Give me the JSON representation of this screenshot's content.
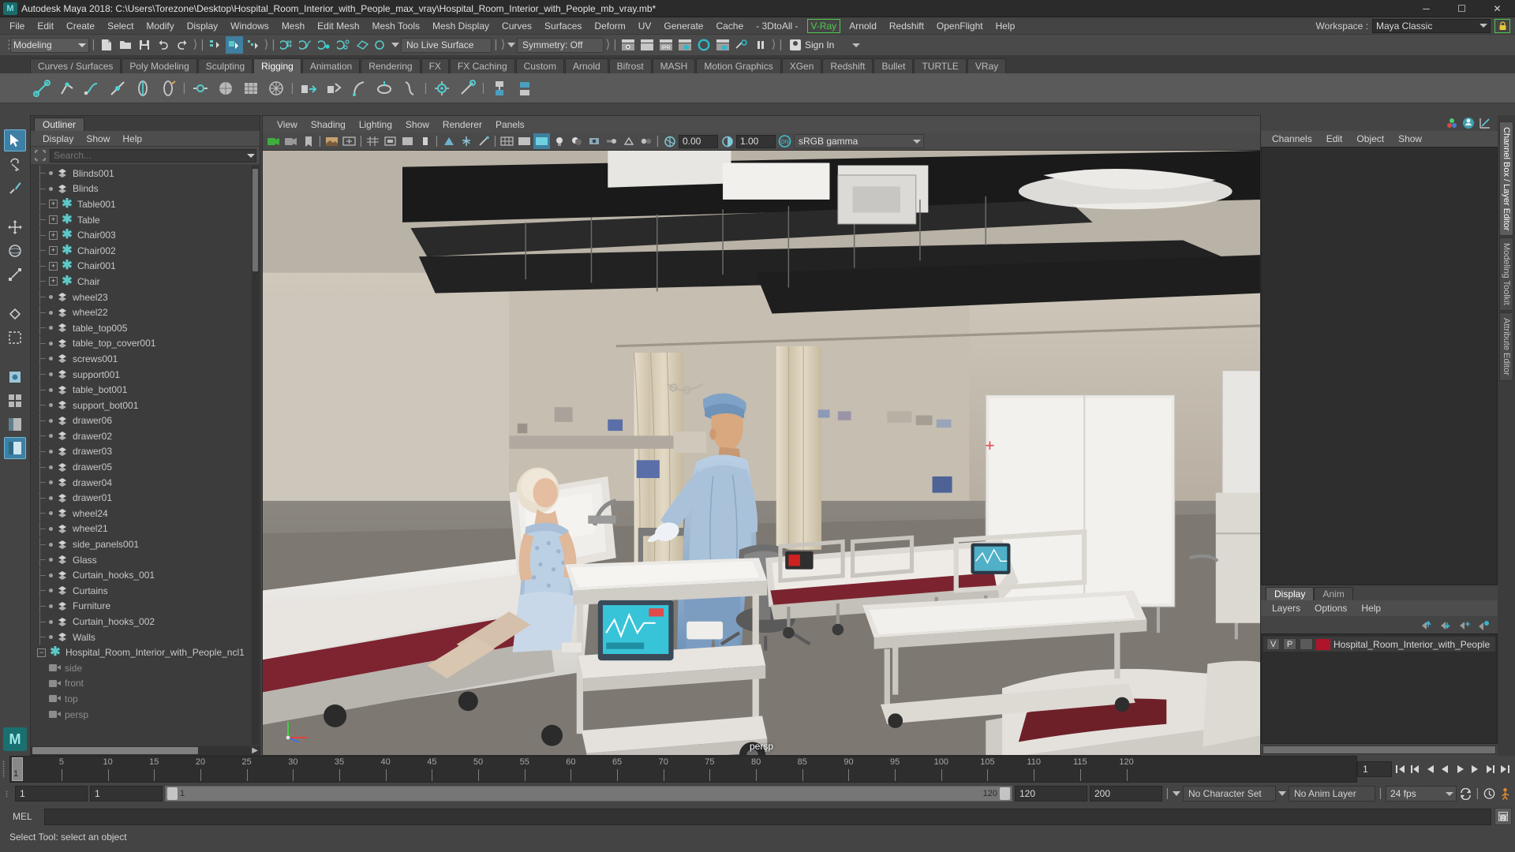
{
  "window": {
    "title": "Autodesk Maya 2018: C:\\Users\\Torezone\\Desktop\\Hospital_Room_Interior_with_People_max_vray\\Hospital_Room_Interior_with_People_mb_vray.mb*",
    "logo": "maya-logo",
    "minimize": "─",
    "maximize": "☐",
    "close": "✕"
  },
  "menubar": {
    "items": [
      "File",
      "Edit",
      "Create",
      "Select",
      "Modify",
      "Display",
      "Windows",
      "Mesh",
      "Edit Mesh",
      "Mesh Tools",
      "Mesh Display",
      "Curves",
      "Surfaces",
      "Deform",
      "UV",
      "Generate",
      "Cache",
      "- 3DtoAll -"
    ],
    "highlighted": "V-Ray",
    "items_after": [
      "Arnold",
      "Redshift",
      "OpenFlight",
      "Help"
    ],
    "workspace_label": "Workspace :",
    "workspace_value": "Maya Classic",
    "lock_icon": "lock-icon",
    "highlight_color": "#4ec94e"
  },
  "statusbar": {
    "mode": "Modeling",
    "live_surface": "No Live Surface",
    "symmetry": "Symmetry: Off",
    "sign_in": "Sign In"
  },
  "shelf": {
    "tabs": [
      "Curves / Surfaces",
      "Poly Modeling",
      "Sculpting",
      "Rigging",
      "Animation",
      "Rendering",
      "FX",
      "FX Caching",
      "Custom",
      "Arnold",
      "Bifrost",
      "MASH",
      "Motion Graphics",
      "XGen",
      "Redshift",
      "Bullet",
      "TURTLE",
      "VRay"
    ],
    "active_tab": "Rigging"
  },
  "outliner": {
    "tab": "Outliner",
    "menu": [
      "Display",
      "Show",
      "Help"
    ],
    "search_placeholder": "Search...",
    "search_icon": "search-icon",
    "nodes": [
      {
        "label": "persp",
        "type": "camera",
        "depth": 0,
        "dim": true
      },
      {
        "label": "top",
        "type": "camera",
        "depth": 0,
        "dim": true
      },
      {
        "label": "front",
        "type": "camera",
        "depth": 0,
        "dim": true
      },
      {
        "label": "side",
        "type": "camera",
        "depth": 0,
        "dim": true
      },
      {
        "label": "Hospital_Room_Interior_with_People_ncl1",
        "type": "group",
        "depth": 0,
        "expanded": true
      },
      {
        "label": "Walls",
        "type": "mesh",
        "depth": 1
      },
      {
        "label": "Curtain_hooks_002",
        "type": "mesh",
        "depth": 1
      },
      {
        "label": "Furniture",
        "type": "mesh",
        "depth": 1
      },
      {
        "label": "Curtains",
        "type": "mesh",
        "depth": 1
      },
      {
        "label": "Curtain_hooks_001",
        "type": "mesh",
        "depth": 1
      },
      {
        "label": "Glass",
        "type": "mesh",
        "depth": 1
      },
      {
        "label": "side_panels001",
        "type": "mesh",
        "depth": 1
      },
      {
        "label": "wheel21",
        "type": "mesh",
        "depth": 1
      },
      {
        "label": "wheel24",
        "type": "mesh",
        "depth": 1
      },
      {
        "label": "drawer01",
        "type": "mesh",
        "depth": 1
      },
      {
        "label": "drawer04",
        "type": "mesh",
        "depth": 1
      },
      {
        "label": "drawer05",
        "type": "mesh",
        "depth": 1
      },
      {
        "label": "drawer03",
        "type": "mesh",
        "depth": 1
      },
      {
        "label": "drawer02",
        "type": "mesh",
        "depth": 1
      },
      {
        "label": "drawer06",
        "type": "mesh",
        "depth": 1
      },
      {
        "label": "support_bot001",
        "type": "mesh",
        "depth": 1
      },
      {
        "label": "table_bot001",
        "type": "mesh",
        "depth": 1
      },
      {
        "label": "support001",
        "type": "mesh",
        "depth": 1
      },
      {
        "label": "screws001",
        "type": "mesh",
        "depth": 1
      },
      {
        "label": "table_top_cover001",
        "type": "mesh",
        "depth": 1
      },
      {
        "label": "table_top005",
        "type": "mesh",
        "depth": 1
      },
      {
        "label": "wheel22",
        "type": "mesh",
        "depth": 1
      },
      {
        "label": "wheel23",
        "type": "mesh",
        "depth": 1
      },
      {
        "label": "Chair",
        "type": "group",
        "depth": 1,
        "collapsed": true
      },
      {
        "label": "Chair001",
        "type": "group",
        "depth": 1,
        "collapsed": true
      },
      {
        "label": "Chair002",
        "type": "group",
        "depth": 1,
        "collapsed": true
      },
      {
        "label": "Chair003",
        "type": "group",
        "depth": 1,
        "collapsed": true
      },
      {
        "label": "Table",
        "type": "group",
        "depth": 1,
        "collapsed": true
      },
      {
        "label": "Table001",
        "type": "group",
        "depth": 1,
        "collapsed": true
      },
      {
        "label": "Blinds",
        "type": "mesh",
        "depth": 1
      },
      {
        "label": "Blinds001",
        "type": "mesh",
        "depth": 1
      }
    ]
  },
  "viewport": {
    "menu": [
      "View",
      "Shading",
      "Lighting",
      "Show",
      "Renderer",
      "Panels"
    ],
    "exposure": "0.00",
    "gamma": "1.00",
    "color_profile": "sRGB gamma",
    "camera_label": "persp",
    "scene": "hospital-room-interior-with-people"
  },
  "channelbox": {
    "menu": [
      "Channels",
      "Edit",
      "Object",
      "Show"
    ],
    "tools": [
      "channel-box-icon",
      "attribute-editor-icon",
      "graph-editor-icon"
    ]
  },
  "layereditor": {
    "tabs": [
      "Display",
      "Anim"
    ],
    "active_tab": "Display",
    "menu": [
      "Layers",
      "Options",
      "Help"
    ],
    "buttons": [
      "move-layer-up-icon",
      "move-layer-down-icon",
      "new-layer-icon",
      "new-layer-from-selected-icon"
    ],
    "layers": [
      {
        "visible": "V",
        "playback": "P",
        "type": "",
        "color": "#b0142a",
        "name": "Hospital_Room_Interior_with_People"
      }
    ]
  },
  "vtabs": {
    "items": [
      "Channel Box / Layer Editor",
      "Modeling Toolkit",
      "Attribute Editor"
    ]
  },
  "timeline": {
    "current_frame": "1",
    "ticks": [
      5,
      10,
      15,
      20,
      25,
      30,
      35,
      40,
      45,
      50,
      55,
      60,
      65,
      70,
      75,
      80,
      85,
      90,
      95,
      100,
      105,
      110,
      115,
      120
    ],
    "playback_field": "1",
    "range_start": "1",
    "range_start2": "1",
    "slider_min_label": "1",
    "slider_max_label": "120",
    "range_end": "120",
    "range_max": "200",
    "character_set": "No Character Set",
    "anim_layer": "No Anim Layer",
    "fps": "24 fps",
    "loop_icon": "loop-icon",
    "anim_pref_icon": "animation-preferences-icon",
    "char_icon": "character-icon"
  },
  "command": {
    "label": "MEL",
    "input_value": "",
    "script_icon": "script-editor-icon"
  },
  "statusline": {
    "text": "Select Tool: select an object"
  },
  "toolbox": {
    "tools": [
      "select-tool",
      "lasso-select-tool",
      "paint-select-tool",
      "move-tool",
      "rotate-tool",
      "scale-tool",
      "last-tool",
      "snap-grid-toggle",
      "snap-curve-toggle",
      "snap-point-toggle",
      "snap-view-toggle",
      "show-manipulator-tool",
      "outliner-persp-layout"
    ],
    "selected": "select-tool"
  }
}
